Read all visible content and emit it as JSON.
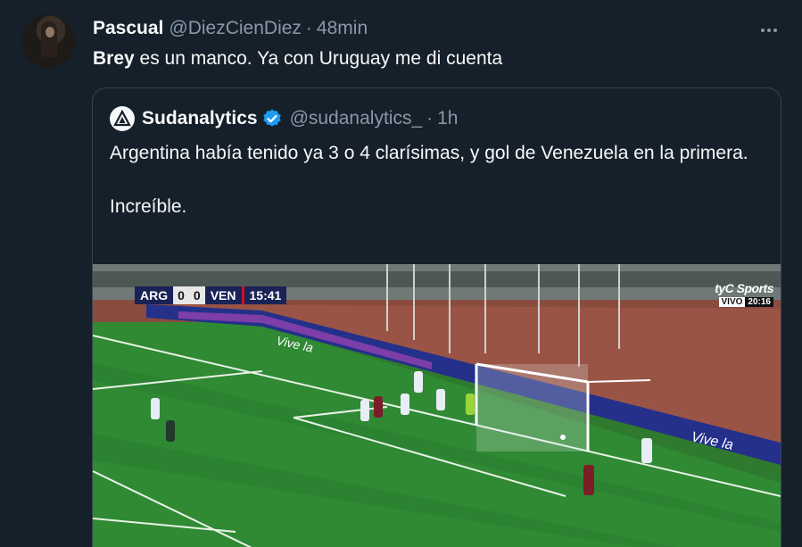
{
  "tweet": {
    "display_name": "Pascual",
    "handle": "@DiezCienDiez",
    "separator": "·",
    "time": "48min",
    "text_bold": "Brey",
    "text_rest": " es un manco. Ya con Uruguay me di cuenta"
  },
  "quote": {
    "display_name": "Sudanalytics",
    "handle": "@sudanalytics_",
    "separator": "·",
    "time": "1h",
    "paragraph_1": "Argentina había tenido ya 3 o 4 clarísimas, y gol de Venezuela en la primera.",
    "paragraph_2": "Increíble."
  },
  "media": {
    "scorebug": {
      "home": "ARG",
      "home_score": "0",
      "away_score": "0",
      "away": "VEN",
      "clock": "15:41"
    },
    "broadcaster": {
      "logo": "tyC Sports",
      "live_label": "VIVO",
      "live_time": "20:16"
    },
    "ad_board_text": "Vive la"
  },
  "colors": {
    "background": "#15202b",
    "text": "#f7f9f9",
    "secondary_text": "#8b98a5",
    "border": "#38444d",
    "verified": "#1d9bf0"
  },
  "icons": {
    "more": "more-horizontal-icon",
    "verified": "verified-badge-icon",
    "quote_avatar": "sudanalytics-logo"
  }
}
